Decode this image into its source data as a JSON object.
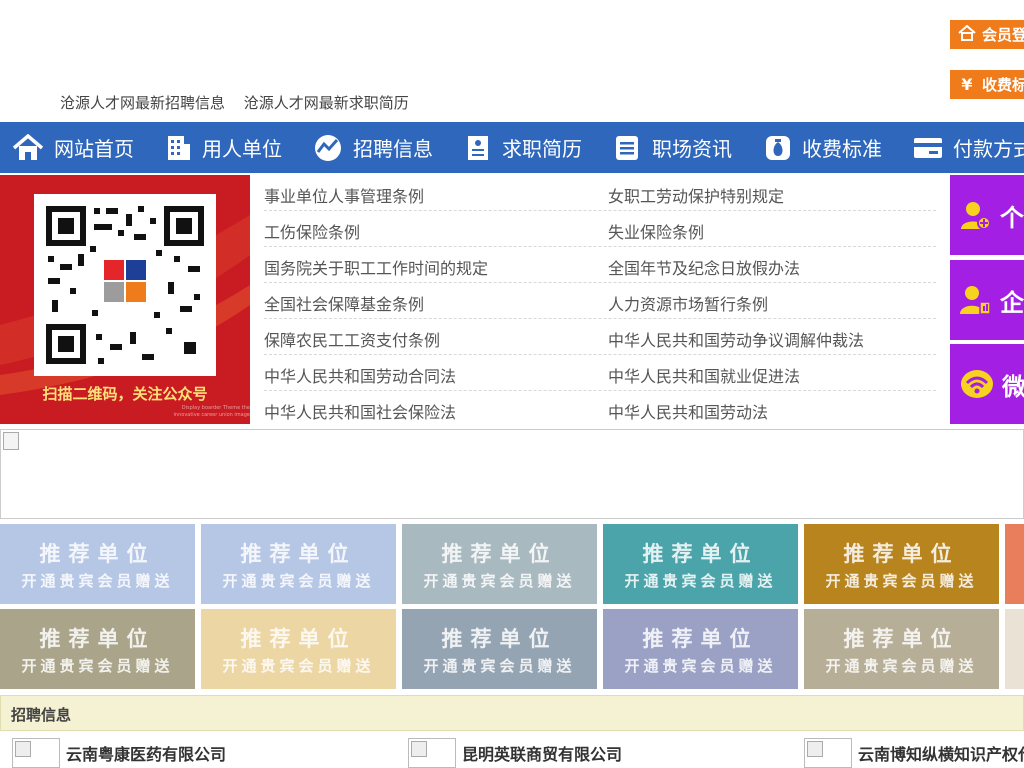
{
  "header": {
    "links": [
      "沧源人才网最新招聘信息",
      "沧源人才网最新求职简历"
    ],
    "member_login": "会员登",
    "fees": "收费标"
  },
  "nav": [
    {
      "label": "网站首页",
      "icon": "home-icon"
    },
    {
      "label": "用人单位",
      "icon": "building-icon"
    },
    {
      "label": "招聘信息",
      "icon": "chart-icon"
    },
    {
      "label": "求职简历",
      "icon": "resume-icon"
    },
    {
      "label": "职场资讯",
      "icon": "news-icon"
    },
    {
      "label": "收费标准",
      "icon": "money-bag-icon"
    },
    {
      "label": "付款方式",
      "icon": "card-icon"
    }
  ],
  "qr": {
    "caption": "扫描二维码，关注公众号",
    "tiny": "Display boarder Theme the innovative career union image"
  },
  "laws": [
    [
      "事业单位人事管理条例",
      "女职工劳动保护特别规定"
    ],
    [
      "工伤保险条例",
      "失业保险条例"
    ],
    [
      "国务院关于职工工作时间的规定",
      "全国年节及纪念日放假办法"
    ],
    [
      "全国社会保障基金条例",
      "人力资源市场暂行条例"
    ],
    [
      "保障农民工工资支付条例",
      "中华人民共和国劳动争议调解仲裁法"
    ],
    [
      "中华人民共和国劳动合同法",
      "中华人民共和国就业促进法"
    ],
    [
      "中华人民共和国社会保险法",
      "中华人民共和国劳动法"
    ]
  ],
  "side_buttons": [
    {
      "label": "个",
      "icon": "person-add-icon"
    },
    {
      "label": "企",
      "icon": "company-user-icon"
    },
    {
      "label": "微",
      "icon": "wechat-icon"
    }
  ],
  "tiles": {
    "title": "推荐单位",
    "subtitle": "开通贵宾会员赠送",
    "colors_row1": [
      "#b6c7e6",
      "#b6c7e6",
      "#a8b9bf",
      "#4ba4a9",
      "#b8841e",
      "#e87e5c"
    ],
    "colors_row2": [
      "#aaa58a",
      "#ecd6a4",
      "#94a4b2",
      "#9aa1c4",
      "#b6ae96",
      "#e9e2d5"
    ]
  },
  "jobs": {
    "header": "招聘信息",
    "companies": [
      "云南粤康医药有限公司",
      "昆明英联商贸有限公司",
      "云南博知纵横知识产权代"
    ]
  }
}
